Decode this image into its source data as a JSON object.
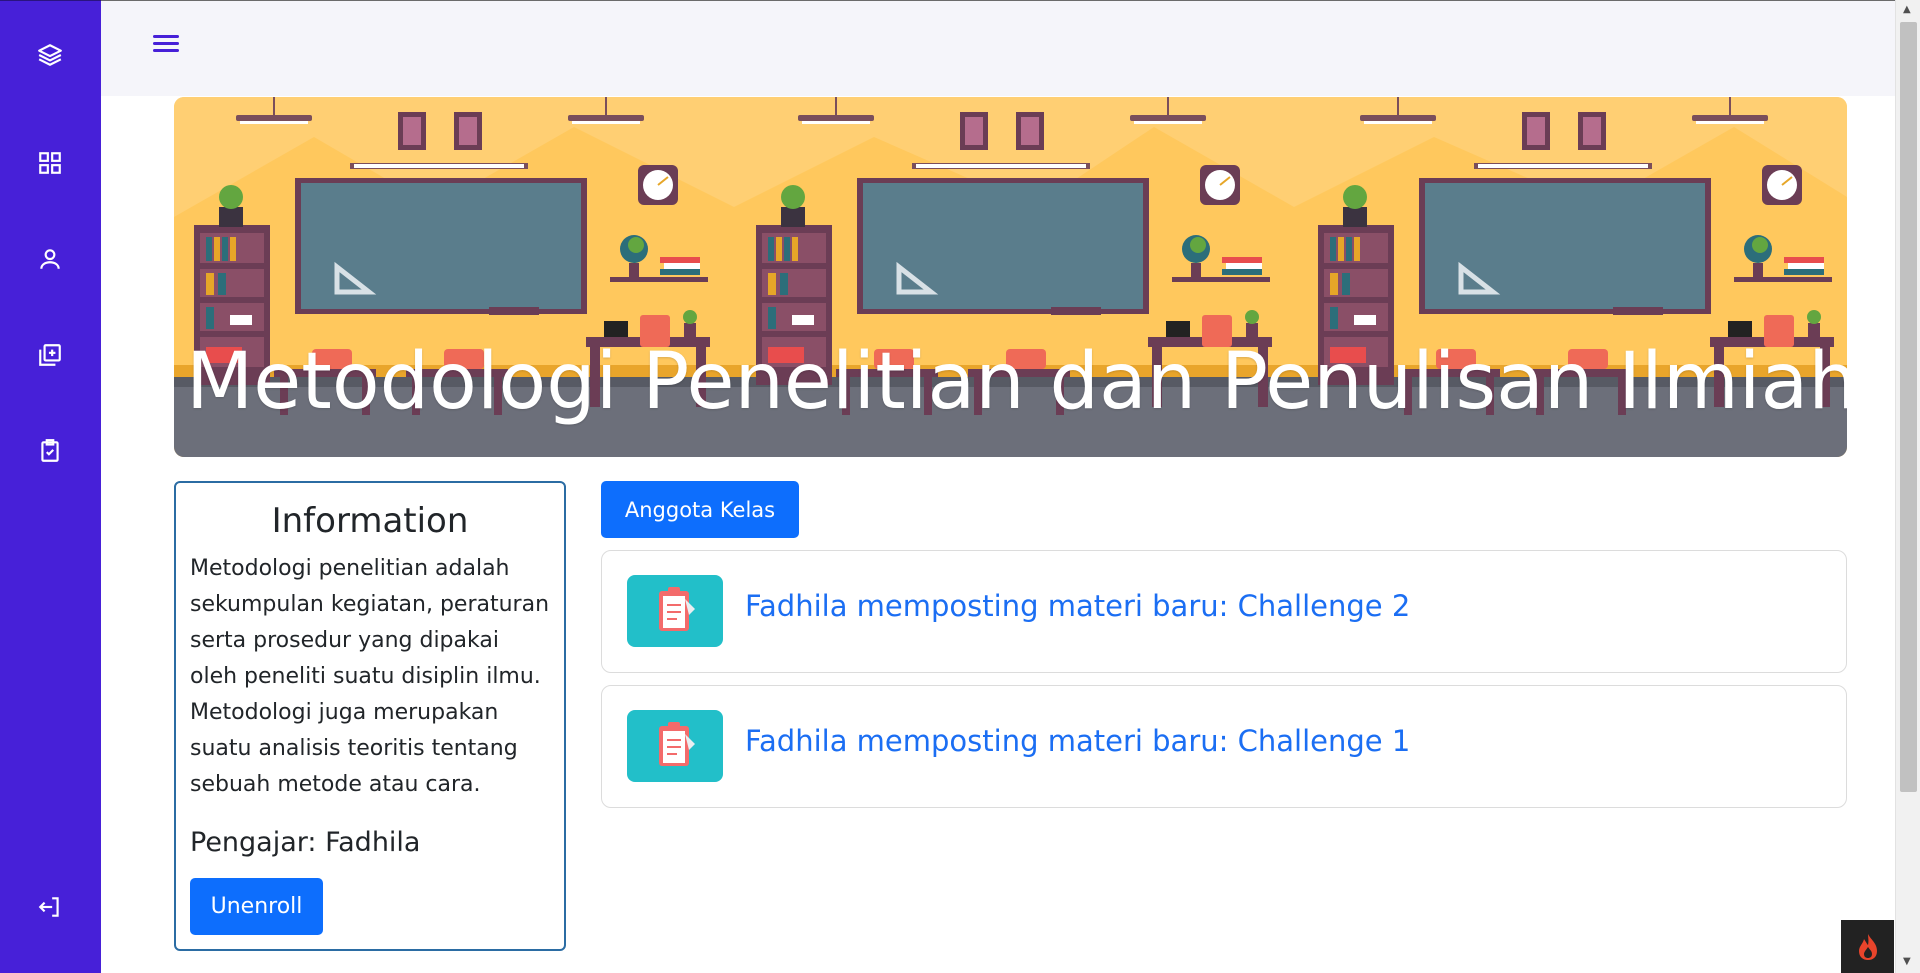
{
  "sidebar": {
    "items": [
      {
        "icon": "layers-icon"
      },
      {
        "icon": "dashboard-grid-icon"
      },
      {
        "icon": "user-icon"
      },
      {
        "icon": "add-copy-icon"
      },
      {
        "icon": "clipboard-check-icon"
      },
      {
        "icon": "logout-icon"
      }
    ]
  },
  "topbar": {
    "menu_icon": "hamburger-menu-icon"
  },
  "banner": {
    "title": "Metodologi Penelitian dan Penulisan Ilmiah"
  },
  "info": {
    "title": "Information",
    "description": "Metodologi penelitian adalah sekumpulan kegiatan, peraturan serta prosedur yang dipakai oleh peneliti suatu disiplin ilmu. Metodologi juga merupakan suatu analisis teoritis tentang sebuah metode atau cara.",
    "teacher": "Pengajar: Fadhila",
    "unenroll_label": "Unenroll"
  },
  "members_button": "Anggota Kelas",
  "posts": [
    {
      "text": "Fadhila memposting materi baru: Challenge 2",
      "icon": "clipboard-icon"
    },
    {
      "text": "Fadhila memposting materi baru: Challenge 1",
      "icon": "clipboard-icon"
    }
  ],
  "colors": {
    "sidebar": "#4720d8",
    "primary": "#0d6efd",
    "post_icon_bg": "#22bfc9",
    "post_link": "#1b6ef3"
  }
}
